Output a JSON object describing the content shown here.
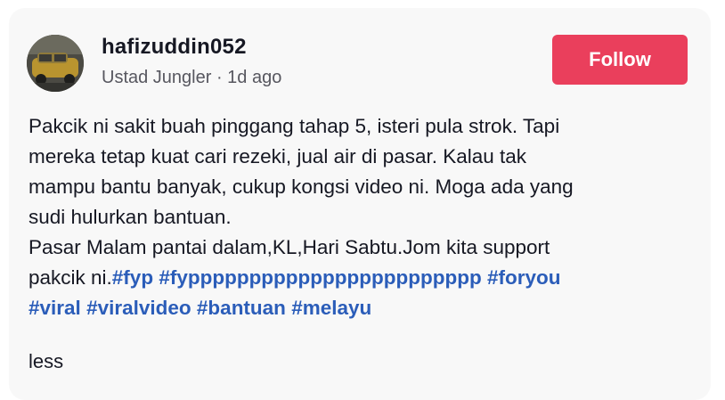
{
  "post": {
    "username": "hafizuddin052",
    "meta": "Ustad Jungler · 1d ago",
    "follow_label": "Follow",
    "caption_lines": [
      "Pakcik ni sakit buah pinggang tahap 5, isteri pula strok. Tapi",
      "mereka tetap kuat cari rezeki, jual air di pasar. Kalau tak",
      "mampu bantu banyak, cukup kongsi video ni. Moga ada yang",
      "sudi hulurkan bantuan.",
      "Pasar Malam pantai dalam,KL,Hari Sabtu.Jom kita support",
      "pakcik ni."
    ],
    "hashtags_line1": [
      "#fyp",
      "#fypppppppppppppppppppppppp",
      "#foryou"
    ],
    "hashtags_line2": [
      "#viral",
      "#viralvideo",
      "#bantuan",
      "#melayu"
    ],
    "less_label": "less"
  },
  "colors": {
    "follow_bg": "#ea3f5c",
    "hashtag": "#2b5db9",
    "card_bg": "#f8f8f8"
  },
  "icons": {
    "avatar": "profile-photo"
  }
}
